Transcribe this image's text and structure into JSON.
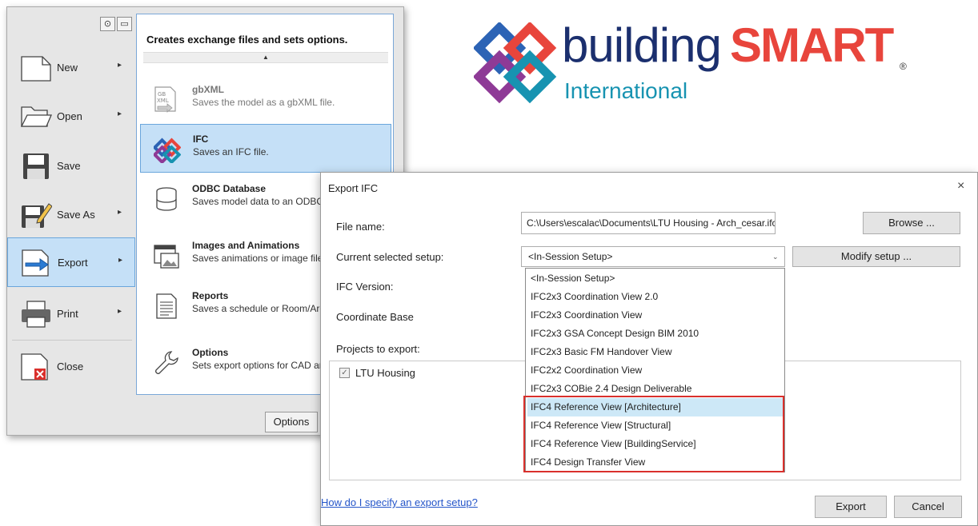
{
  "app_menu": {
    "items": [
      {
        "label": "New",
        "icon": "new-document-icon",
        "has_arrow": true
      },
      {
        "label": "Open",
        "icon": "open-folder-icon",
        "has_arrow": true
      },
      {
        "label": "Save",
        "icon": "save-disk-icon",
        "has_arrow": false
      },
      {
        "label": "Save As",
        "icon": "save-as-icon",
        "has_arrow": true
      },
      {
        "label": "Export",
        "icon": "export-icon",
        "has_arrow": true,
        "active": true
      },
      {
        "label": "Print",
        "icon": "printer-icon",
        "has_arrow": true
      },
      {
        "label": "Close",
        "icon": "close-document-icon",
        "has_arrow": false
      }
    ],
    "arrow": "▸"
  },
  "submenu": {
    "title": "Creates exchange files and sets options.",
    "scroll_up": "▲",
    "items": [
      {
        "title": "gbXML",
        "desc": "Saves the model as a gbXML file.",
        "icon": "gbxml-icon",
        "disabled": true
      },
      {
        "title": "IFC",
        "desc": "Saves an IFC file.",
        "icon": "ifc-icon",
        "active": true
      },
      {
        "title": "ODBC Database",
        "desc": "Saves model data to an ODBC database.",
        "icon": "database-icon"
      },
      {
        "title": "Images and Animations",
        "desc": "Saves animations or image files.",
        "icon": "film-icon"
      },
      {
        "title": "Reports",
        "desc": "Saves a schedule or Room/Area report.",
        "icon": "report-icon"
      },
      {
        "title": "Options",
        "desc": "Sets export options for CAD and IFC.",
        "icon": "wrench-icon"
      }
    ],
    "options_button": "Options"
  },
  "logo": {
    "word1": "building",
    "word2": "SMART",
    "registered": "®",
    "subtitle": "International",
    "colors": {
      "navy": "#1b2f6e",
      "red": "#e8453c",
      "teal": "#1793b1",
      "purple": "#8e3a96",
      "blue": "#2c63b5"
    }
  },
  "dialog": {
    "title": "Export IFC",
    "close_glyph": "×",
    "file_name_label": "File name:",
    "file_name_value": "C:\\Users\\escalac\\Documents\\LTU Housing - Arch_cesar.ifc",
    "browse_button": "Browse ...",
    "setup_label": "Current selected setup:",
    "setup_value": "<In-Session Setup>",
    "modify_button": "Modify setup ...",
    "ifc_version_label": "IFC Version:",
    "coordinate_label": "Coordinate Base",
    "projects_label": "Projects to export:",
    "project_name": "LTU Housing",
    "project_checked": true,
    "dropdown_options": [
      "<In-Session Setup>",
      "IFC2x3 Coordination View 2.0",
      "IFC2x3 Coordination View",
      "IFC2x3 GSA Concept Design BIM 2010",
      "IFC2x3 Basic FM Handover View",
      "IFC2x2 Coordination View",
      "IFC2x3 COBie 2.4 Design Deliverable",
      "IFC4 Reference View [Architecture]",
      "IFC4 Reference View [Structural]",
      "IFC4 Reference View [BuildingService]",
      "IFC4 Design Transfer View"
    ],
    "selected_option": "IFC4 Reference View [Architecture]",
    "help_link": "How do I specify an export setup?",
    "export_button": "Export",
    "cancel_button": "Cancel"
  }
}
